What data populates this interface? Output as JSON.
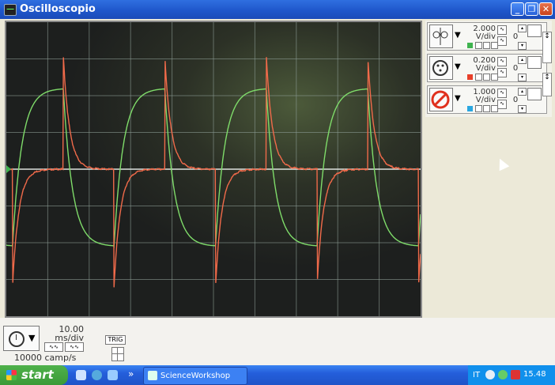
{
  "window": {
    "title": "Oscilloscopio",
    "buttons": {
      "minimize": "_",
      "restore": "❐",
      "close": "✕"
    }
  },
  "channels": [
    {
      "value": "2.000",
      "unit": "V/div",
      "offset": "0",
      "color": "#3fb34f",
      "icon": "oscilloscope-probe-icon"
    },
    {
      "value": "0.200",
      "unit": "V/div",
      "offset": "0",
      "color": "#e8402a",
      "icon": "sensor-plug-icon"
    },
    {
      "value": "1.000",
      "unit": "V/div",
      "offset": "0",
      "color": "#2aa7e0",
      "icon": "no-input-icon"
    }
  ],
  "timebase": {
    "value": "10.00",
    "unit": "ms/div",
    "rate": "10000 camp/s"
  },
  "trigger": {
    "label": "TRIG"
  },
  "taskbar": {
    "start_label": "start",
    "task_label": "ScienceWorkshop",
    "chevron": "»",
    "language": "IT",
    "clock": "15.48"
  },
  "chart_data": {
    "type": "line",
    "xlabel": "",
    "ylabel": "",
    "divisions": {
      "x": 10,
      "y": 8
    },
    "series": [
      {
        "color": "#7fdc6a",
        "pulse_period_div": 2.45,
        "pulse_start_div": 0.15,
        "high_div": 2.2,
        "low_div": -2.1,
        "time_constant_div": 0.22
      },
      {
        "color": "#f06a4a",
        "pulse_period_div": 2.45,
        "pulse_start_div": 0.15,
        "spike_peak_div": 3.1,
        "spike_min_div": -3.2,
        "time_constant_div": 0.15
      }
    ]
  }
}
